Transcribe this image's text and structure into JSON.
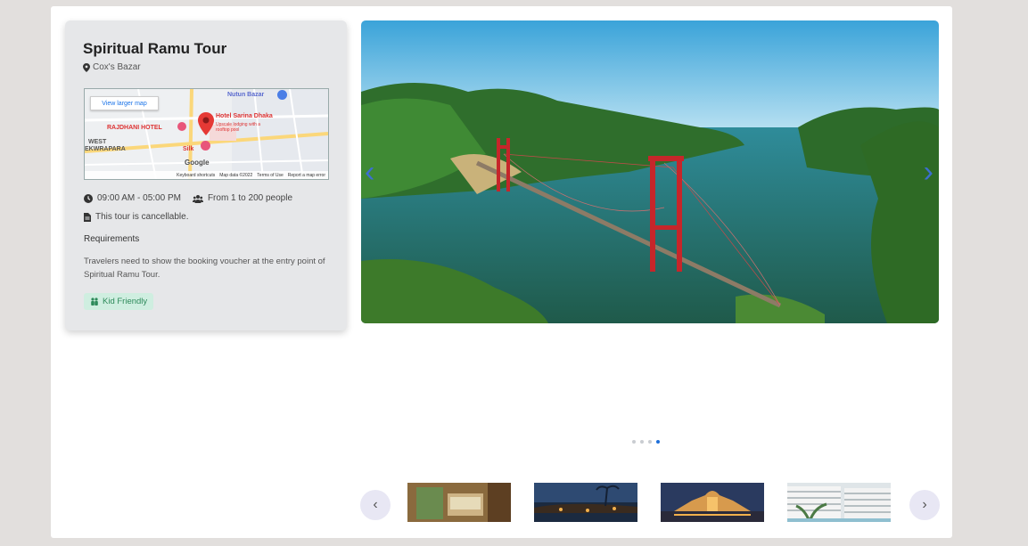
{
  "tour": {
    "title": "Spiritual Ramu Tour",
    "location": "Cox's Bazar",
    "time": "09:00 AM - 05:00 PM",
    "group": "From 1 to 200 people",
    "cancel": "This tour is cancellable.",
    "requirements_title": "Requirements",
    "requirements_text": "Travelers need to show the booking voucher at the entry point of Spiritual Ramu Tour.",
    "badge": "Kid Friendly"
  },
  "map": {
    "view_link": "View larger map",
    "labels": {
      "nutan_bazar": "Nutun Bazar",
      "rajdhani": "RAJDHANI HOTEL",
      "hotel_sarina": "Hotel Sarina Dhaka",
      "hotel_sub": "Upscale lodging with a rooftop pool",
      "west": "WEST",
      "ekwrapara": "EKWRAPARA",
      "silk": "Silk",
      "google": "Google"
    },
    "footer": [
      "Keyboard shortcuts",
      "Map data ©2022",
      "Terms of Use",
      "Report a map error"
    ]
  },
  "carousel": {
    "prev": "‹",
    "next": "›",
    "dot_count": 4,
    "active_dot": 3
  },
  "thumbnails": {
    "prev": "‹",
    "next": "›"
  },
  "icons": {
    "location": "map-pin-icon",
    "time": "clock-icon",
    "group": "users-icon",
    "cancel": "document-icon",
    "badge": "child-icon"
  }
}
